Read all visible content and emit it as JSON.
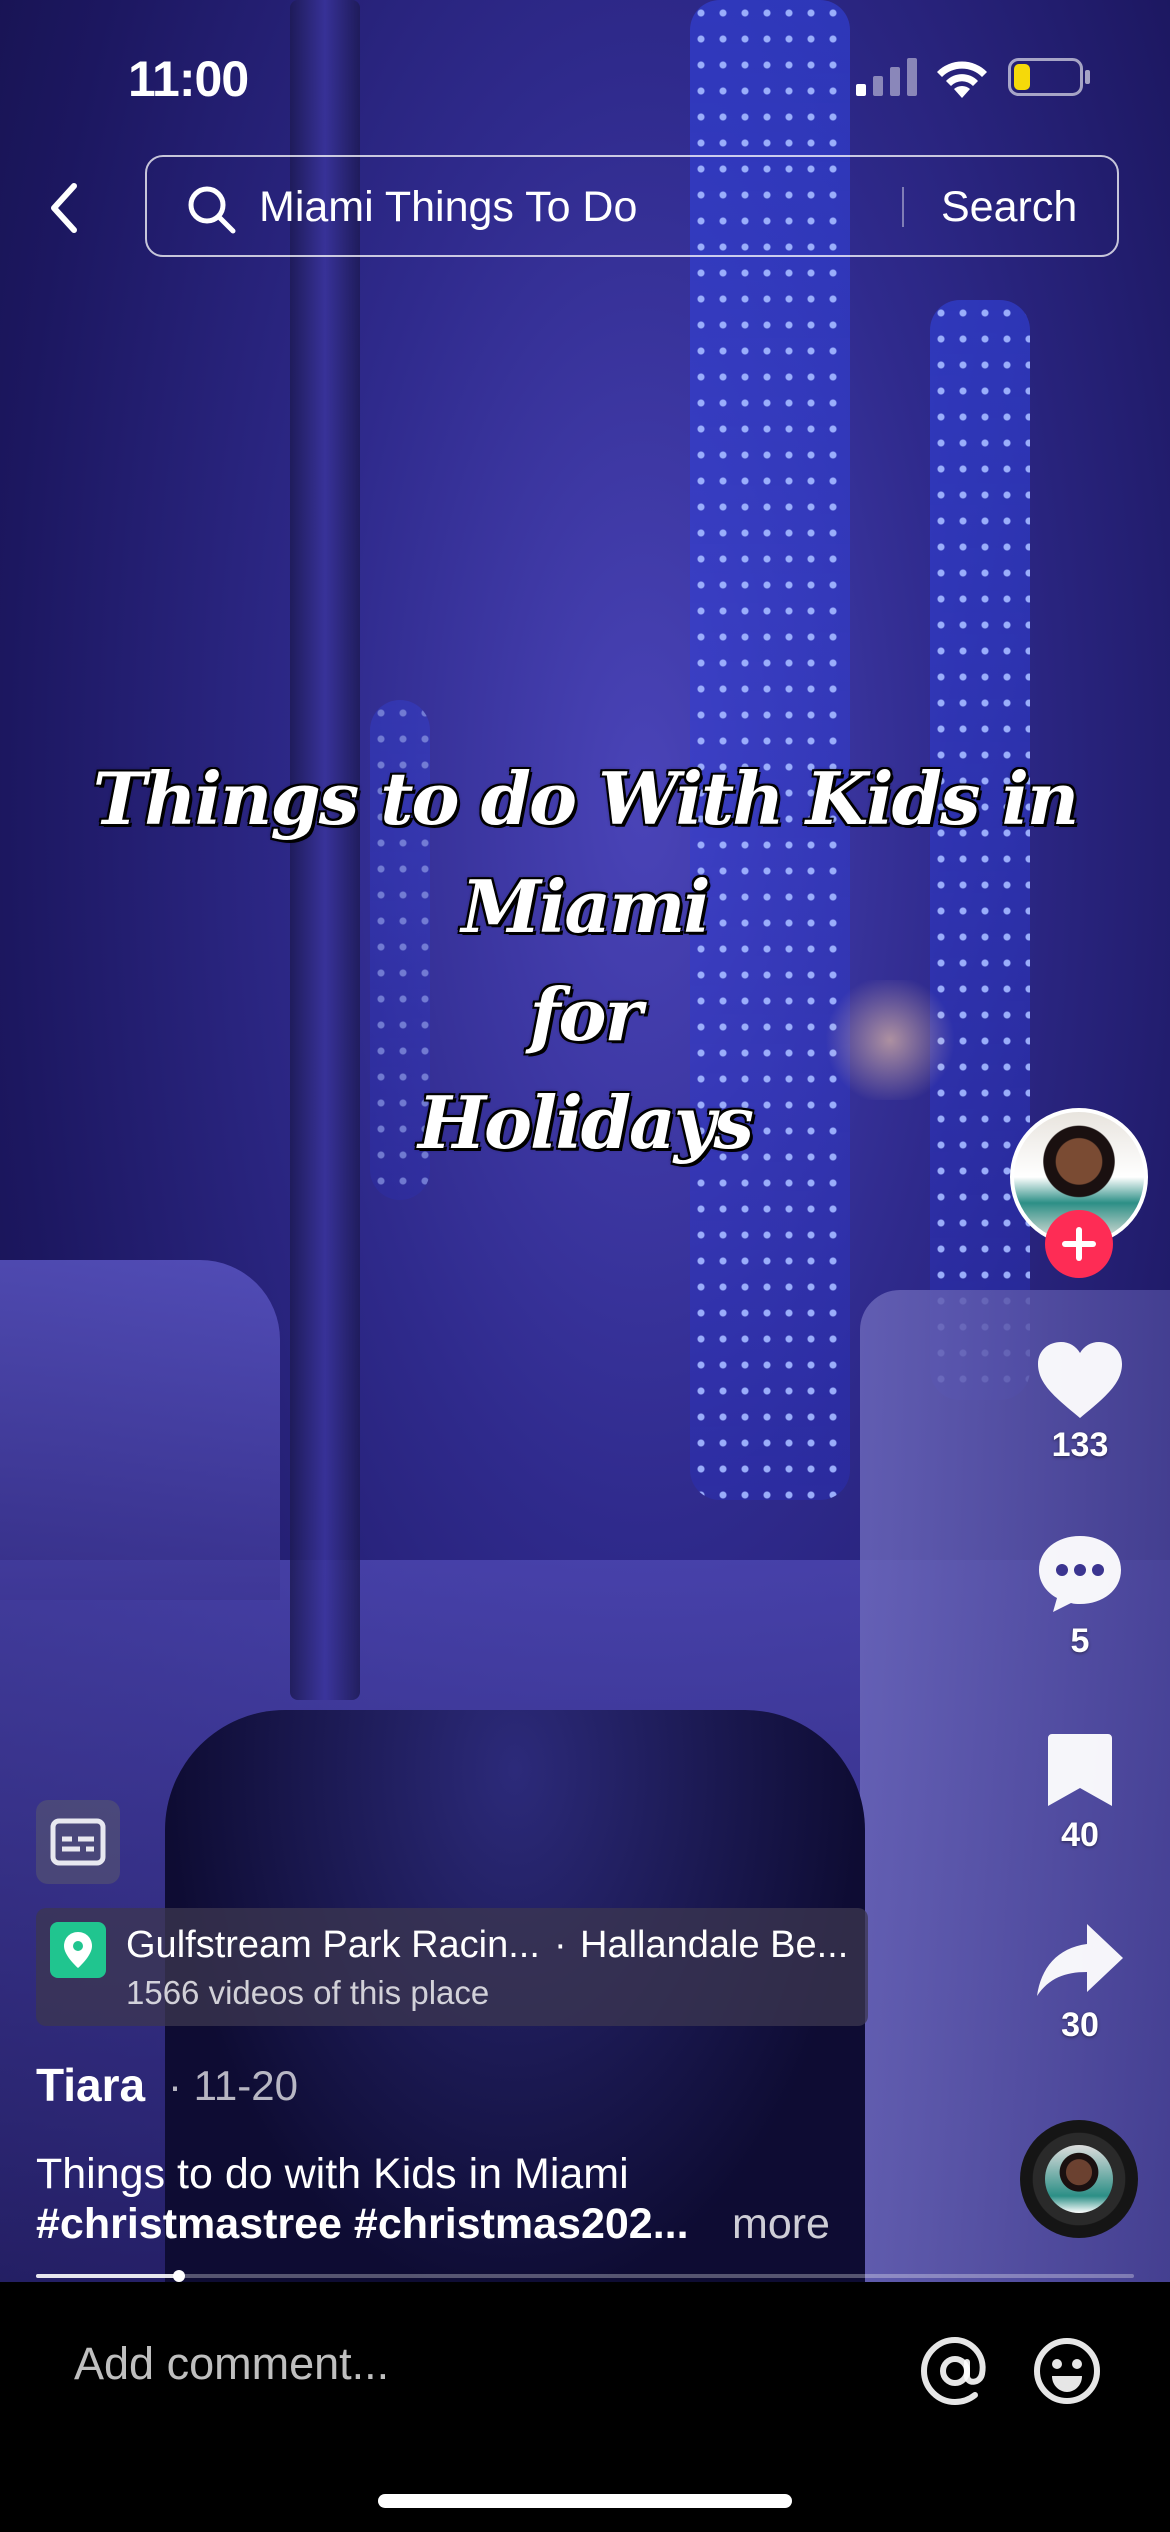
{
  "status_bar": {
    "time": "11:00",
    "battery_level": 0.25,
    "battery_color": "#f5d90a"
  },
  "search": {
    "query": "Miami Things To Do",
    "button_label": "Search"
  },
  "video": {
    "overlay_lines": [
      "Things to do With Kids in",
      "Miami",
      "for",
      "Holidays"
    ]
  },
  "creator": {
    "username": "Tiara",
    "date": "· 11-20"
  },
  "actions": {
    "likes": "133",
    "comments": "5",
    "saves": "40",
    "shares": "30"
  },
  "location": {
    "name": "Gulfstream Park Racin...",
    "separator": "·",
    "city": "Hallandale Be...",
    "subtitle": "1566 videos of this place",
    "pin_color": "#20c58f"
  },
  "caption": {
    "line1": "Things to do with Kids in Miami",
    "line2": "#christmastree #christmas202...",
    "more": "more"
  },
  "progress": {
    "fraction": 0.13
  },
  "comment_bar": {
    "placeholder": "Add comment..."
  },
  "colors": {
    "follow_accent": "#fe2c55"
  }
}
